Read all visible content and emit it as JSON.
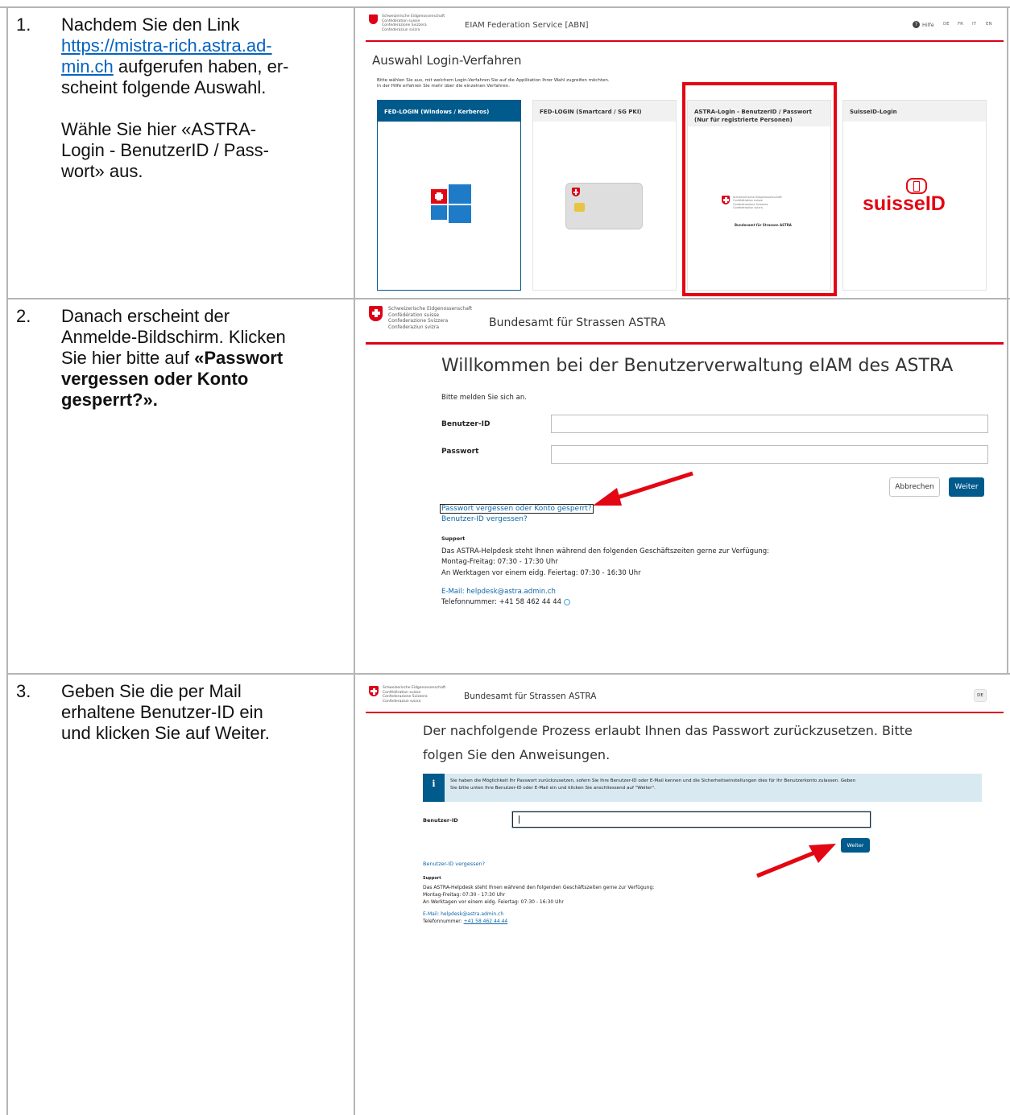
{
  "steps": [
    {
      "number": "1.",
      "text_before_link": "Nachdem Sie den Link",
      "link": "https://mistra-rich.astra.ad-min.ch",
      "link_line1": "https://mistra-rich.astra.ad-",
      "link_line2": "min.ch",
      "text_after_link": " aufgerufen haben, er-",
      "text_line3": "scheint folgende Auswahl.",
      "para2_line1": "Wähle Sie hier «ASTRA-",
      "para2_line2": "Login - BenutzerID / Pass-",
      "para2_line3": "wort» aus."
    },
    {
      "number": "2.",
      "line1": "Danach erscheint der",
      "line2": "Anmelde-Bildschirm. Klicken",
      "line3_plain": "Sie hier bitte auf ",
      "line3_bold": "«Passwort",
      "line4_bold": "vergessen oder Konto",
      "line5_bold": "gesperrt?»."
    },
    {
      "number": "3.",
      "line1": "Geben Sie die per Mail",
      "line2": "erhaltene Benutzer-ID ein",
      "line3": "und klicken Sie auf Weiter."
    }
  ],
  "swiss_logo": {
    "line1": "Schweizerische Eidgenossenschaft",
    "line2": "Confédération suisse",
    "line3": "Confederazione Svizzera",
    "line4": "Confederaziun svizra"
  },
  "shot1": {
    "app_title": "EIAM Federation Service [ABN]",
    "help_label": "Hilfe",
    "languages": [
      "DE",
      "FR",
      "IT",
      "EN"
    ],
    "heading": "Auswahl Login-Verfahren",
    "intro_line1": "Bitte wählen Sie aus, mit welchem Login-Verfahren Sie auf die Applikation Ihrer Wahl zugreifen möchten.",
    "intro_line2": "In der Hilfe erfahren Sie mehr über die einzelnen Verfahren.",
    "cards": [
      {
        "title": "FED-LOGIN (Windows / Kerberos)"
      },
      {
        "title": "FED-LOGIN (Smartcard / SG PKI)"
      },
      {
        "title": "ASTRA-Login - BenutzerID / Passwort",
        "subtitle": "(Nur für registrierte Personen)"
      },
      {
        "title": "SuisseID-Login"
      }
    ],
    "astra_card_caption": "Bundesamt für Strassen ASTRA",
    "suisseid_text": "suisseID"
  },
  "shot2": {
    "office": "Bundesamt für Strassen ASTRA",
    "heading": "Willkommen bei der Benutzerverwaltung eIAM des ASTRA",
    "prompt": "Bitte melden Sie sich an.",
    "user_label": "Benutzer-ID",
    "password_label": "Passwort",
    "cancel_label": "Abbrechen",
    "next_label": "Weiter",
    "forgot_password": "Passwort vergessen oder Konto gesperrt?",
    "forgot_user": "Benutzer-ID vergessen?",
    "support_title": "Support",
    "support_line1": "Das ASTRA-Helpdesk steht Ihnen während den folgenden Geschäftszeiten gerne zur Verfügung:",
    "support_line2": "Montag-Freitag: 07:30 - 17:30 Uhr",
    "support_line3": "An Werktagen vor einem eidg. Feiertag: 07:30 - 16:30 Uhr",
    "email": "E-Mail: helpdesk@astra.admin.ch",
    "phone": "Telefonnummer: +41 58 462 44 44"
  },
  "shot3": {
    "office": "Bundesamt für Strassen ASTRA",
    "lang_button": "DE",
    "heading_line1": "Der nachfolgende Prozess erlaubt Ihnen das Passwort zurückzusetzen. Bitte",
    "heading_line2": "folgen Sie den Anweisungen.",
    "info_icon": "i",
    "info_line1": "Sie haben die Möglichkeit Ihr Passwort zurückzusetzen, sofern Sie Ihre Benutzer-ID oder E-Mail kennen und die Sicherheitseinstellungen dies für Ihr Benutzerkonto zulassen. Geben",
    "info_line2": "Sie bitte unten Ihre Benutzer-ID oder E-Mail ein und klicken Sie anschliessend auf \"Weiter\".",
    "user_label": "Benutzer-ID",
    "next_label": "Weiter",
    "forgot_user": "Benutzer-ID vergessen?",
    "support_title": "Support",
    "support_line1": "Das ASTRA-Helpdesk steht Ihnen während den folgenden Geschäftszeiten gerne zur Verfügung:",
    "support_line2": "Montag-Freitag: 07:30 - 17:30 Uhr",
    "support_line3": "An Werktagen vor einem eidg. Feiertag: 07:30 - 16:30 Uhr",
    "email": "E-Mail: helpdesk@astra.admin.ch",
    "phone_label": "Telefonnummer: ",
    "phone_number": "+41 58 462 44 44"
  }
}
